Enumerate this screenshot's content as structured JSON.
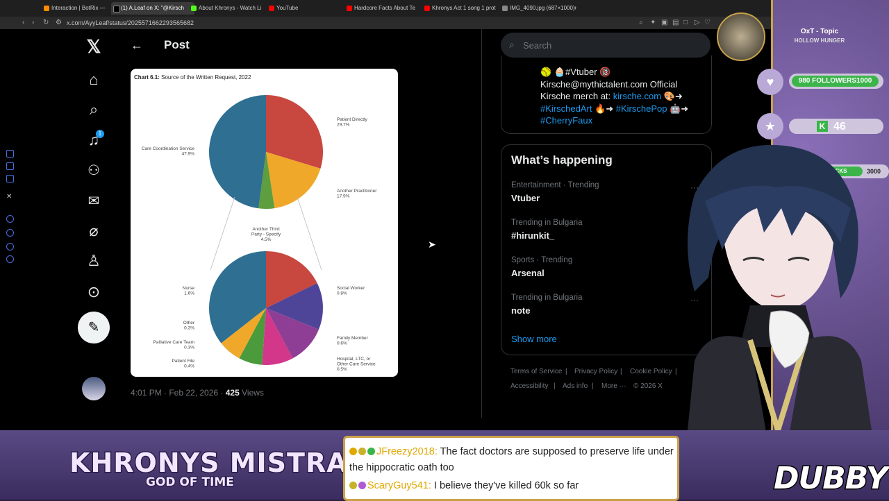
{
  "browser": {
    "tabs": [
      {
        "label": "Interaction | BotRix —",
        "color": "#ff8a00"
      },
      {
        "label": "(1) A.Leaf on X: \"@Kirsch",
        "color": "#111111",
        "active": true
      },
      {
        "label": "About Khronys - Watch Li",
        "color": "#53fc18"
      },
      {
        "label": "YouTube",
        "color": "#ff0000"
      },
      {
        "label": "Hardcore Facts About Te",
        "color": "#ff0000"
      },
      {
        "label": "Khronys Act 1 song 1 prot",
        "color": "#ff0000"
      },
      {
        "label": "IMG_4090.jpg (687×1000)",
        "color": "#888888"
      }
    ],
    "new_tab": "+",
    "url": "x.com/AyyLeaf/status/2025571662293565682"
  },
  "x_nav": {
    "logo": "𝕏",
    "notification_count": "1",
    "post_icon": "✎"
  },
  "post": {
    "back": "←",
    "title": "Post",
    "timestamp": "4:01 PM · Feb 22, 2026 · ",
    "views_count": "425",
    "views_label": " Views"
  },
  "chart_data": [
    {
      "type": "pie",
      "title": "Chart 6.1:",
      "subtitle": "Source of the Written Request, 2022",
      "categories": [
        "Patient Directly",
        "Another Practitioner",
        "Another Third Party - Specify",
        "Care Coordination Service"
      ],
      "values": [
        29.7,
        17.9,
        4.5,
        47.9
      ],
      "labels": [
        "Patient Directly\n29.7%",
        "Another Practitioner\n17.9%",
        "Another Third\nParty - Specify\n4.5%",
        "Care Coordination Service\n47.9%"
      ],
      "colors": [
        "#c8473f",
        "#f0a82a",
        "#5e9e3e",
        "#2f6f92"
      ]
    },
    {
      "type": "pie",
      "title": "",
      "categories": [
        "Social Worker",
        "Family Member",
        "Hospital, LTC, or Other Care Service",
        "Patient File",
        "Palliative Care Team",
        "Other",
        "Nurse"
      ],
      "values": [
        0.8,
        0.6,
        0.5,
        0.4,
        0.3,
        0.3,
        1.6
      ],
      "labels": [
        "Social Worker\n0.8%",
        "Family Member\n0.6%",
        "Hospital, LTC, or\nOther Care Service\n0.5%",
        "Patient File\n0.4%",
        "Palliative Care Team\n0.3%",
        "Other\n0.3%",
        "Nurse\n1.6%"
      ],
      "colors": [
        "#c8473f",
        "#4f4598",
        "#8e3f95",
        "#d2378a",
        "#4b9a3c",
        "#f0a82a",
        "#2f6f92"
      ]
    }
  ],
  "right": {
    "search_placeholder": "Search",
    "bio": {
      "line1": "🥎 🧁#Vtuber 🔞",
      "line2": "Kirsche@mythictalent.com Official",
      "line3a": "Kirsche merch at: ",
      "line3b": "kirsche.com",
      "line3c": " 🎨➜",
      "line4a": "#KirschedArt",
      "line4b": " 🔥➜ ",
      "line4c": "#KirschePop",
      "line4d": " 🤖➜",
      "line5": "#CherryFaux"
    },
    "trending_title": "What’s happening",
    "trends": [
      {
        "meta": "Entertainment · Trending",
        "name": "Vtuber"
      },
      {
        "meta": "Trending in Bulgaria",
        "name": "#hirunkit_"
      },
      {
        "meta": "Sports · Trending",
        "name": "Arsenal"
      },
      {
        "meta": "Trending in Bulgaria",
        "name": "note"
      }
    ],
    "show_more": "Show more",
    "footer": [
      "Terms of Service",
      "|",
      "Privacy Policy",
      "|",
      "Cookie Policy",
      "|",
      "Accessibility",
      "|",
      "Ads info",
      "|",
      "More ···",
      "© 2026 X"
    ]
  },
  "overlay": {
    "topic": "OxT - Topic",
    "topic_sub": "HOLLOW HUNGER",
    "followers_value": "980",
    "followers_label": "FOLLOWERS",
    "followers_goal": "1000",
    "followers_progress": 0.98,
    "kick_count": "46",
    "kicks_label": "KICKS",
    "kicks_goal": "3000",
    "logo_title": "KHRONYS MISTRAL",
    "logo_sub": "GOD OF TIME",
    "signature": "DUBBY"
  },
  "chat": [
    {
      "user": "JFreezy2018:",
      "text": " The fact doctors are supposed to preserve life under",
      "user_color": "#e0a800"
    },
    {
      "user": "",
      "text": "the hippocratic oath too",
      "user_color": "#222"
    },
    {
      "user": "ScaryGuy541:",
      "text": " I believe they've killed 60k so far",
      "user_color": "#e0a800"
    }
  ]
}
